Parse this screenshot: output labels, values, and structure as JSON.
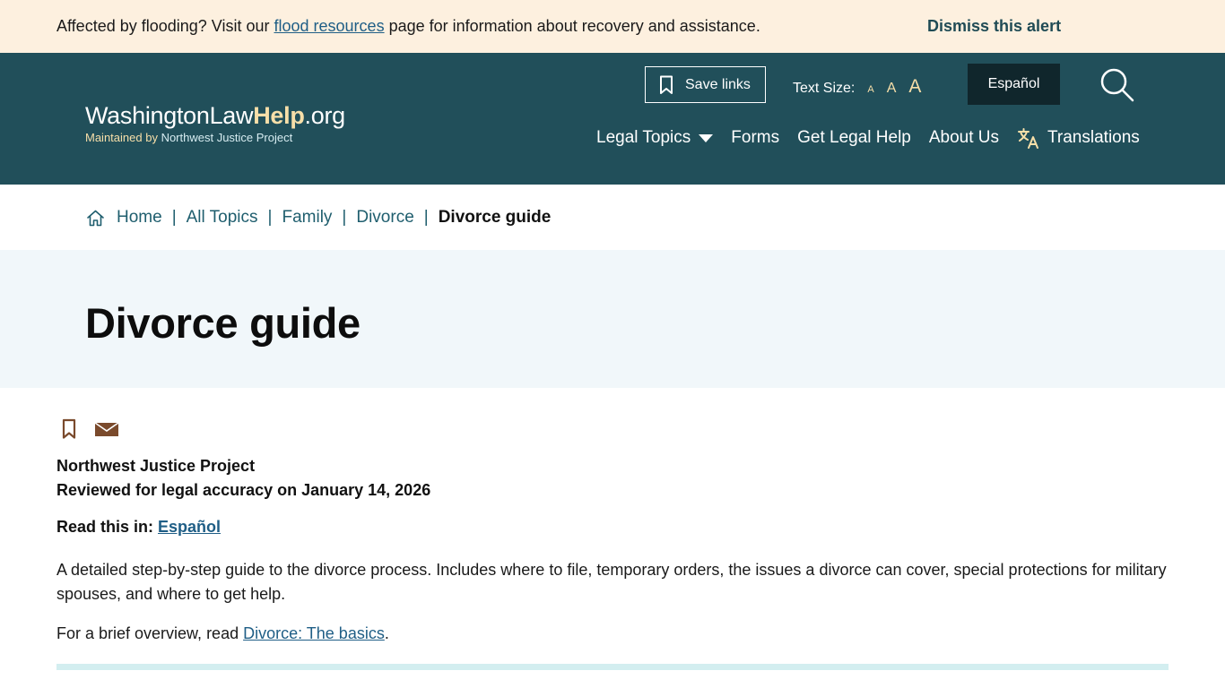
{
  "alert": {
    "text_before": "Affected by flooding? Visit our ",
    "link_text": "flood resources",
    "text_after": " page for information about recovery and assistance.",
    "dismiss_label": "Dismiss this alert"
  },
  "header": {
    "logo_prefix": "WashingtonLaw",
    "logo_help": "Help",
    "logo_suffix": ".org",
    "logo_sub_prefix": "Maintained by ",
    "logo_sub_org": "Northwest Justice Project",
    "save_links_label": "Save links",
    "text_size_label": "Text Size:",
    "text_size_options": [
      "A",
      "A",
      "A"
    ],
    "espanol_label": "Español",
    "search_icon": "search-icon",
    "nav": {
      "legal_topics": "Legal Topics",
      "forms": "Forms",
      "get_legal_help": "Get Legal Help",
      "about_us": "About Us",
      "translations": "Translations"
    }
  },
  "breadcrumb": {
    "home": "Home",
    "all_topics": "All Topics",
    "family": "Family",
    "divorce": "Divorce",
    "current": "Divorce guide",
    "separator": "|"
  },
  "page": {
    "title": "Divorce guide",
    "author": "Northwest Justice Project",
    "reviewed": "Reviewed for legal accuracy on January 14, 2026",
    "read_in_label": "Read this in: ",
    "read_in_link": "Español",
    "summary": "A detailed step-by-step guide to the divorce process. Includes where to file, temporary orders, the issues a divorce can cover, special protections for military spouses, and where to get help.",
    "overview_before": "For a brief overview, read ",
    "overview_link": "Divorce: The basics",
    "overview_after": "."
  },
  "colors": {
    "alert_bg": "#fdf0df",
    "header_bg": "#214f5a",
    "accent_gold": "#f7dfa9",
    "title_band_bg": "#f1f7fa",
    "link": "#1f5e86",
    "icon_brown": "#7a4a2c"
  }
}
